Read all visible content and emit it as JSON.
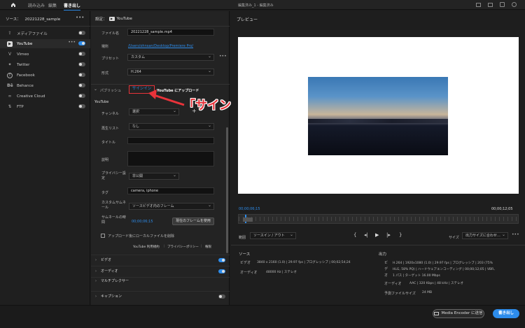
{
  "topbar": {
    "tabs": [
      "読み込み",
      "編集",
      "書き出し"
    ],
    "title": "編集済み_1 - 編集済み"
  },
  "source_panel": {
    "header": "ソース：",
    "file": "20221228_sample",
    "destinations": [
      {
        "label": "メディアファイル",
        "icon": "export-icon",
        "on": false
      },
      {
        "label": "YouTube",
        "icon": "youtube-icon",
        "on": true
      },
      {
        "label": "Vimeo",
        "icon": "vimeo-icon",
        "on": false
      },
      {
        "label": "Twitter",
        "icon": "twitter-icon",
        "on": false
      },
      {
        "label": "Facebook",
        "icon": "facebook-icon",
        "on": false
      },
      {
        "label": "Behance",
        "icon": "behance-icon",
        "on": false
      },
      {
        "label": "Creative Cloud",
        "icon": "creative-cloud-icon",
        "on": false
      },
      {
        "label": "FTP",
        "icon": "ftp-icon",
        "on": false
      }
    ]
  },
  "settings": {
    "header": "設定：",
    "platform": "YouTube",
    "filename_label": "ファイル名",
    "filename_value": "20221228_sample.mp4",
    "location_label": "場所",
    "location_value": "/Users/ohnsan/Desktop/Premiere Pro/",
    "preset_label": "プリセット",
    "preset_value": "カスタム",
    "format_label": "形式",
    "format_value": "H.264",
    "publish_label": "パブリッシュ",
    "signin_label": "サインイン",
    "upload_label": "YouTube にアップロード",
    "youtube_label": "YouTube",
    "channel_label": "チャンネル",
    "channel_value": "選択",
    "playlist_label": "再生リスト",
    "playlist_value": "なし",
    "title_label": "タイトル",
    "description_label": "説明",
    "privacy_label": "プライバシー設定",
    "privacy_value": "非公開",
    "tags_label": "タグ",
    "tags_value": "camera, iphone",
    "thumb_label": "カスタムサムネール",
    "thumb_value": "ソースビデオ内のフレーム",
    "thumb_time_label": "サムネールの時間",
    "thumb_time_value": "00;00;06;15",
    "use_frame_button": "現在のフレームを使用",
    "delete_local_label": "アップロード後にローカルファイルを削除",
    "links": [
      "YouTube 利用規約",
      "プライバシーポリシー",
      "権限"
    ],
    "sections": [
      "ビデオ",
      "オーディオ",
      "マルチプレクサー",
      "キャプション"
    ]
  },
  "annotation": {
    "text": "「サインイン」を選択"
  },
  "preview": {
    "header": "プレビュー",
    "time_start": "00;00;06;15",
    "time_end": "00;00;12;05",
    "range_label": "範囲",
    "range_value": "ソースイン / アウト",
    "size_label": "サイズ",
    "size_value": "出力サイズに合わせ…"
  },
  "info": {
    "source_header": "ソース",
    "source_video_label": "ビデオ",
    "source_video_value": "3840 x 2160 (1.0)  |  29.97 fps  |  プログレッシブ  |  00;02;54;24",
    "source_audio_label": "オーディオ",
    "source_audio_value": "48000 Hz  |  ステレオ",
    "output_header": "出力",
    "output_video_label": "ビデオ",
    "output_video_value": "H.264  |  1920x1080 (1.0)  |  29.97 fps  |  プログレッシブ  |  203 (75% HLG, 58% PQ)  |  ハードウェアエンコーディング  |  00;00;12;05  |  VBR、1 パス  |  ターゲット 16.00 Mbps",
    "output_audio_label": "オーディオ",
    "output_audio_value": "AAC  |  320 Kbps  |  48 kHz  |  ステレオ",
    "filesize_label": "予測ファイルサイズ",
    "filesize_value": "24 MB"
  },
  "footer": {
    "encoder_button": "Media Encoder に送信",
    "export_button": "書き出し"
  },
  "colors": {
    "accent": "#2d8ceb",
    "annotation": "#e8333a"
  }
}
